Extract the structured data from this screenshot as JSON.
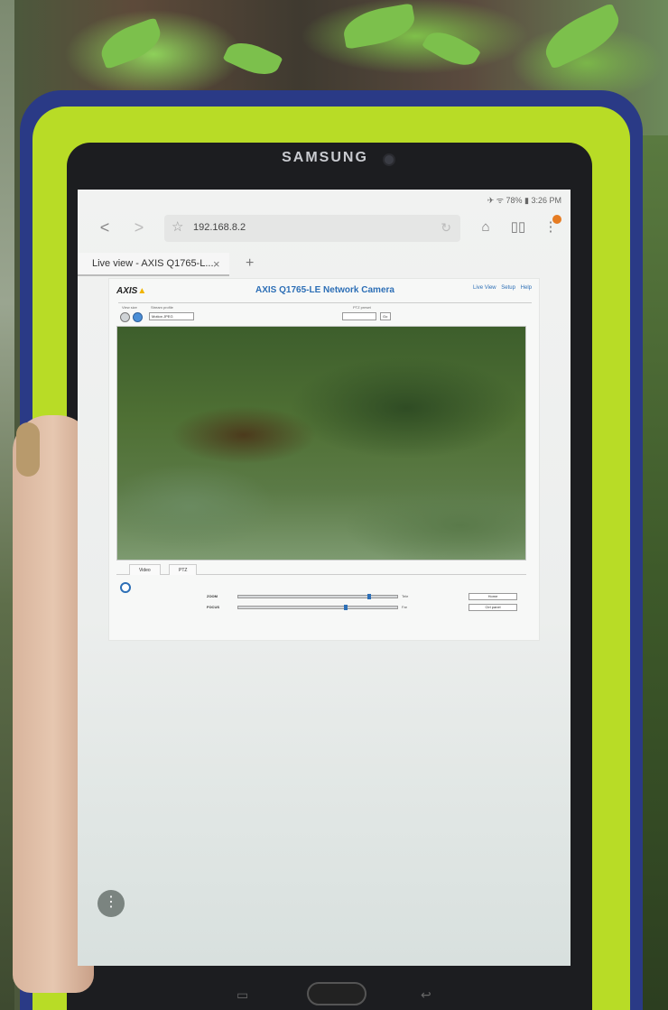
{
  "device": {
    "brand": "SAMSUNG"
  },
  "statusbar": {
    "battery": "78%",
    "time": "3:26 PM"
  },
  "browser": {
    "url": "192.168.8.2",
    "tab_title": "Live view - AXIS Q1765-L...",
    "tab_close": "×",
    "tab_add": "+",
    "back": "<",
    "forward": ">"
  },
  "axis_page": {
    "logo": "AXIS",
    "title": "AXIS Q1765-LE Network Camera",
    "links": [
      "Live View",
      "Setup",
      "Help"
    ],
    "view_size_label": "View size",
    "stream_profile_label": "Stream profile",
    "stream_profile_value": "Motion JPEG",
    "ptz_preset_label": "PTZ preset",
    "ptz_preset_go": "Go",
    "subtabs": [
      "Video",
      "PTZ"
    ],
    "zoom": {
      "label": "ZOOM",
      "level": 0.82,
      "far_end": "Tele",
      "button": "Home"
    },
    "focus": {
      "label": "FOCUS",
      "level": 0.67,
      "far_end": "Far",
      "button": "Ctrl panel"
    }
  },
  "colors": {
    "case_blue": "#2a3a86",
    "case_lime": "#b8dc26",
    "axis_blue": "#2d6fb6",
    "notif": "#e67c22"
  },
  "icons": {
    "bookmark": "star-icon",
    "reload": "reload-icon",
    "home": "home-icon",
    "reader": "book-icon",
    "more": "more-icon"
  }
}
